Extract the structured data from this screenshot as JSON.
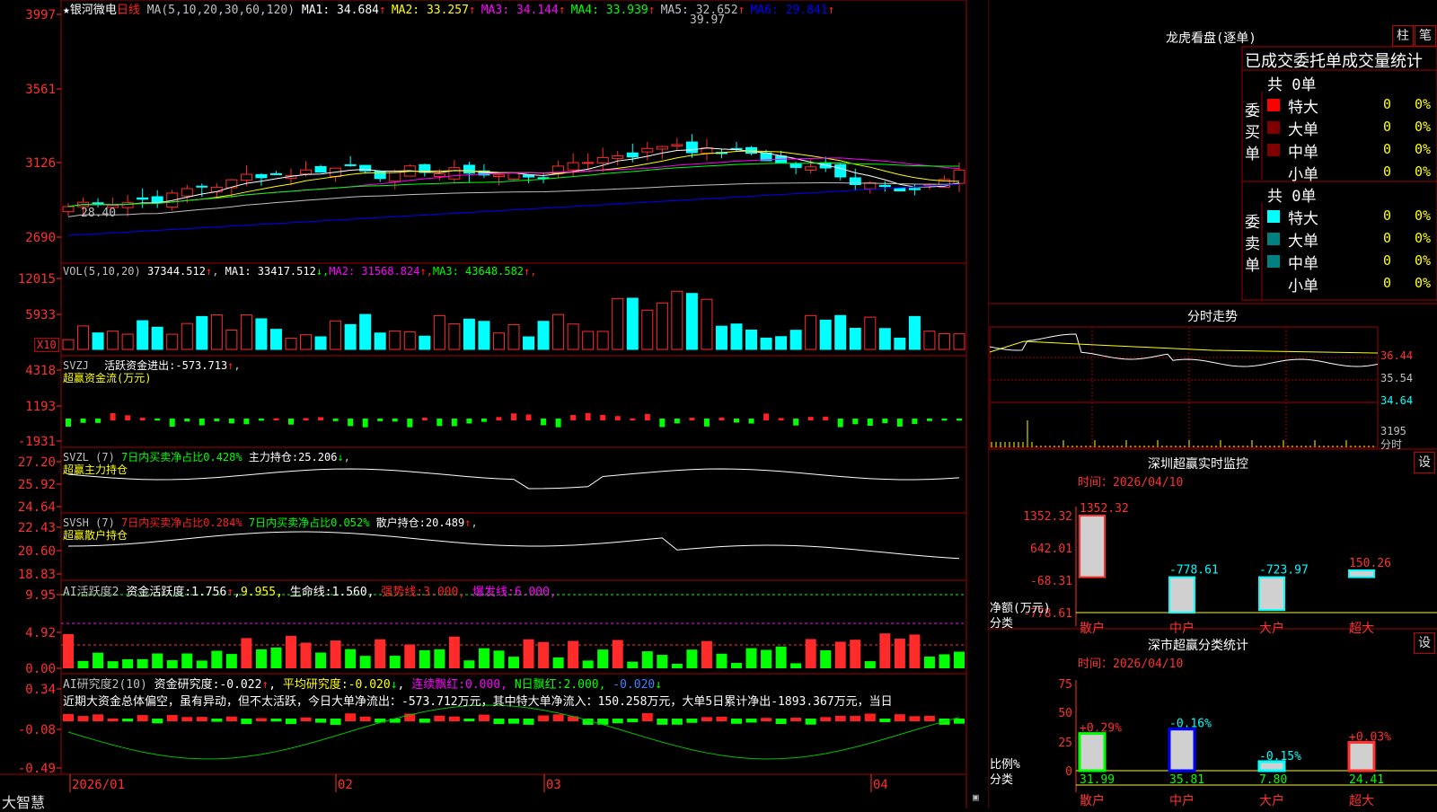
{
  "colors": {
    "up": "#ff2b2b",
    "down": "#00ffff",
    "grid": "#a00000",
    "ma1": "#ffffff",
    "ma2": "#ffff00",
    "ma3": "#ff00ff",
    "ma4": "#00ff00",
    "ma5": "#c0c0c0",
    "ma6": "#0000ff"
  },
  "kline": {
    "star": "★",
    "name": "银河微电",
    "period": "日线",
    "ma_label": "MA(5,10,20,30,60,120)",
    "ma": [
      {
        "key": "MA1",
        "label": "MA1:",
        "value": "34.684",
        "arrow": "↑",
        "color": "#ffffff"
      },
      {
        "key": "MA2",
        "label": "MA2:",
        "value": "33.257",
        "arrow": "↑",
        "color": "#ffff00"
      },
      {
        "key": "MA3",
        "label": "MA3:",
        "value": "34.144",
        "arrow": "↑",
        "color": "#ff00ff"
      },
      {
        "key": "MA4",
        "label": "MA4:",
        "value": "33.939",
        "arrow": "↑",
        "color": "#00ff00"
      },
      {
        "key": "MA5",
        "label": "MA5:",
        "value": "32.652",
        "arrow": "↑",
        "color": "#c0c0c0"
      },
      {
        "key": "MA6",
        "label": "MA6:",
        "value": "29.841",
        "arrow": "↑",
        "color": "#0000ff"
      }
    ],
    "y_ticks": [
      "3997",
      "3561",
      "3126",
      "2690"
    ],
    "high_label": "39.97",
    "low_label": "28.40"
  },
  "vol": {
    "label": "VOL(5,10,20)",
    "value": "37344.512",
    "arrow": "↑",
    "ma": [
      {
        "label": "MA1:",
        "value": "33417.512",
        "arrow": "↓",
        "color": "#ffffff"
      },
      {
        "label": "MA2:",
        "value": "31568.824",
        "arrow": "↑",
        "color": "#ff00ff"
      },
      {
        "label": "MA3:",
        "value": "43648.582",
        "arrow": "↑",
        "color": "#00ff00"
      }
    ],
    "y_ticks": [
      "12015",
      "5933"
    ],
    "unit": "X10"
  },
  "svzj": {
    "title": "SVZJ",
    "item": "活跃资金进出:",
    "value": "-573.713",
    "arrow": "↑",
    "tail": ",",
    "sub": "超赢资金流(万元)",
    "y_ticks": [
      "4318",
      "1193",
      "-1931"
    ]
  },
  "svzl": {
    "title": "SVZL (7)",
    "item1": "7日内买卖净占比0.428%",
    "item2": "主力持仓:",
    "value": "25.206",
    "arrow": "↓",
    "tail": ",",
    "sub": "超赢主力持仓",
    "y_ticks": [
      "27.20",
      "25.92",
      "24.64"
    ]
  },
  "svsh": {
    "title": "SVSH (7)",
    "item1": "7日内买卖净占比0.284%",
    "item2": "7日内买卖净占比0.052%",
    "item3": "散户持仓:",
    "value": "20.489",
    "arrow": "↑",
    "tail": ",",
    "sub": "超赢散户持仓",
    "y_ticks": [
      "22.43",
      "20.60",
      "18.83"
    ]
  },
  "ai_active": {
    "title": "AI活跃度2",
    "item1": "资金活跃度:",
    "v1": "1.756",
    "a1": "↑",
    "v2": "9.955,",
    "item3": "生命线:",
    "v3": "1.560,",
    "item4": "强势线:",
    "v4": "3.000,",
    "item5": "爆发线:",
    "v5": "6.000,",
    "y_ticks": [
      "9.95",
      "4.92",
      "0.00"
    ]
  },
  "ai_research": {
    "title": "AI研究度2(10)",
    "item1": "资金研究度:",
    "v1": "-0.022",
    "a1": "↑",
    "item2": "平均研究度:",
    "v2": "-0.020",
    "a2": "↓",
    "item3": "连续飘红:",
    "v3": "0.000,",
    "item4": "N日飘红:",
    "v4": "2.000,",
    "v5": "-0.020",
    "a5": "↓",
    "y_ticks": [
      "0.34",
      "-0.08",
      "-0.49"
    ],
    "summary": "近期大资金总体偏空，虽有异动，但不太活跃，今日大单净流出：-573.712万元，其中特大单净流入：150.258万元，大单5日累计净出-1893.367万元，当日"
  },
  "x_axis": [
    "2026/01",
    "02",
    "03",
    "04"
  ],
  "brand": "大智慧",
  "dragon": {
    "title": "龙虎看盘(逐单)",
    "btn1": "柱",
    "btn2": "笔",
    "header": "已成交委托单成交量统计",
    "buy": {
      "side": "委买单",
      "total": "共 0单",
      "rows": [
        {
          "label": "特大",
          "count": "0",
          "pct": "0%",
          "color": "#ff0000"
        },
        {
          "label": "大单",
          "count": "0",
          "pct": "0%",
          "color": "#800000"
        },
        {
          "label": "中单",
          "count": "0",
          "pct": "0%",
          "color": "#800000"
        },
        {
          "label": "小单",
          "count": "0",
          "pct": "0%",
          "color": "#000000"
        }
      ]
    },
    "sell": {
      "side": "委卖单",
      "total": "共 0单",
      "rows": [
        {
          "label": "特大",
          "count": "0",
          "pct": "0%",
          "color": "#00ffff"
        },
        {
          "label": "大单",
          "count": "0",
          "pct": "0%",
          "color": "#008080"
        },
        {
          "label": "中单",
          "count": "0",
          "pct": "0%",
          "color": "#008080"
        },
        {
          "label": "小单",
          "count": "0",
          "pct": "0%",
          "color": "#000000"
        }
      ]
    }
  },
  "minute": {
    "title": "分时走势",
    "y_ticks": [
      "36.44",
      "35.54",
      "34.64"
    ],
    "vol_label": "3195",
    "vol_unit": "分时"
  },
  "monitor": {
    "title": "深圳超赢实时监控",
    "btn": "设",
    "time_label": "时间：",
    "time": "2026/04/10",
    "y_ticks": [
      "1352.32",
      "642.01",
      "-68.31",
      "-778.61"
    ],
    "unit_label": "净额(万元)",
    "cat_label": "分类",
    "chart_data": {
      "type": "bar",
      "categories": [
        "散户",
        "中户",
        "大户",
        "超大"
      ],
      "values": [
        1352.32,
        -778.61,
        -723.97,
        150.26
      ],
      "value_labels": [
        "1352.32",
        "-778.61",
        "-723.97",
        "150.26"
      ],
      "ylim": [
        -778.61,
        1352.32
      ]
    }
  },
  "classify": {
    "title": "深市超赢分类统计",
    "btn": "设",
    "time_label": "时间：",
    "time": "2026/04/10",
    "y_ticks": [
      "75",
      "50",
      "25",
      "0"
    ],
    "unit_label": "比例%",
    "cat_label": "分类",
    "chart_data": {
      "type": "bar",
      "categories": [
        "散户",
        "中户",
        "大户",
        "超大"
      ],
      "values": [
        31.99,
        35.81,
        7.8,
        24.41
      ],
      "value_labels": [
        "31.99",
        "35.81",
        "7.80",
        "24.41"
      ],
      "changes": [
        "+0.29%",
        "-0.16%",
        "-0.15%",
        "+0.03%"
      ],
      "ylim": [
        0,
        75
      ]
    }
  }
}
